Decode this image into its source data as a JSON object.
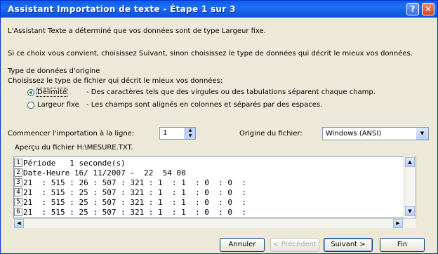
{
  "window": {
    "title": "Assistant Importation de texte - Étape 1 sur 3"
  },
  "intro": {
    "line1": "L'Assistant Texte a déterminé que vos données sont de type Largeur fixe.",
    "line2": "Si ce choix vous convient, choisissez Suivant, sinon choisissez le type de données qui décrit le mieux vos données."
  },
  "source_type": {
    "heading": "Type de données d'origine",
    "prompt": "Choisissez le type de fichier qui décrit le mieux vos données:",
    "options": [
      {
        "label": "Délimité",
        "desc": "- Des caractères tels que des virgules ou des tabulations séparent chaque champ.",
        "selected": true
      },
      {
        "label": "Largeur fixe",
        "desc": "- Les champs sont alignés en colonnes et séparés par des espaces.",
        "selected": false
      }
    ]
  },
  "start_row": {
    "label": "Commencer l'importation à la ligne:",
    "value": "1"
  },
  "file_origin": {
    "label": "Origine du fichier:",
    "value": "Windows (ANSI)"
  },
  "preview": {
    "label": "Aperçu du fichier H:\\MESURE.TXT.",
    "rows": [
      {
        "num": "1",
        "text": "Période   1 seconde(s)"
      },
      {
        "num": "2",
        "text": "Date-Heure 16/ 11/2007 -  22  54 00"
      },
      {
        "num": "3",
        "text": "21  : 515 : 26 : 507 : 321 : 1  : 1  : 0  : 0  :"
      },
      {
        "num": "4",
        "text": "21  : 515 : 25 : 507 : 321 : 1  : 1  : 0  : 0  :"
      },
      {
        "num": "5",
        "text": "21  : 515 : 25 : 507 : 321 : 1  : 1  : 0  : 0  :"
      },
      {
        "num": "6",
        "text": "21  : 515 : 25 : 507 : 321 : 1  : 1  : 0  : 0  :"
      }
    ]
  },
  "buttons": {
    "cancel": "Annuler",
    "previous": "< Précédent",
    "next": "Suivant >",
    "finish": "Fin"
  }
}
